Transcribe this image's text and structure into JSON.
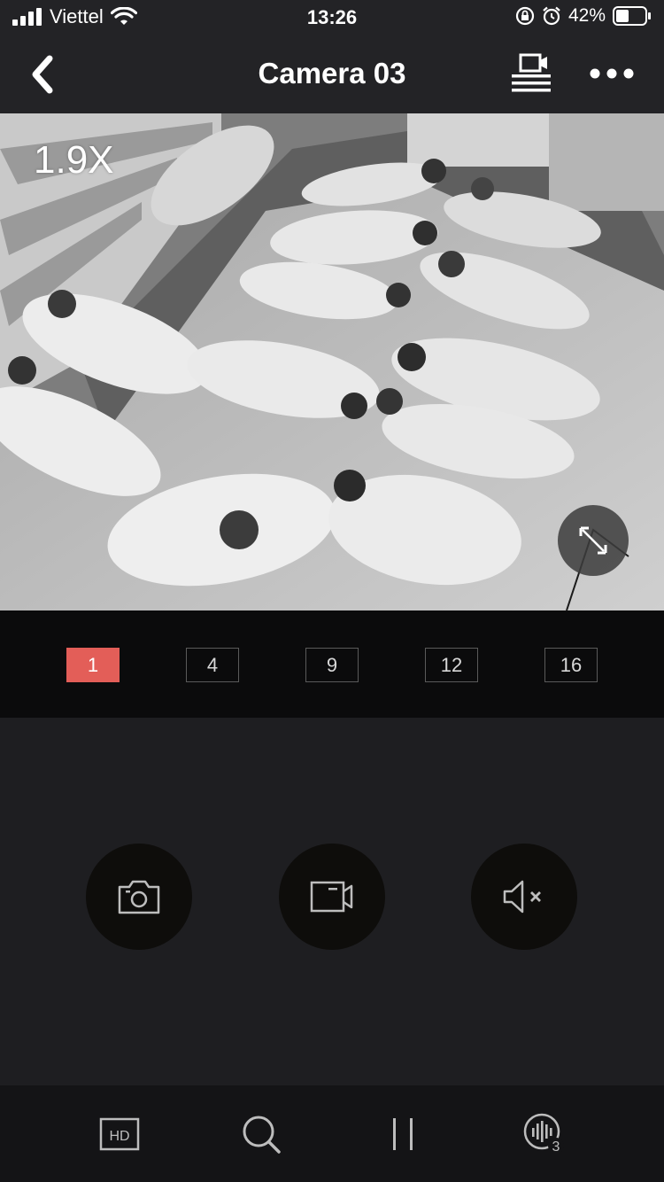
{
  "status_bar": {
    "carrier": "Viettel",
    "time": "13:26",
    "battery": "42%"
  },
  "nav": {
    "title": "Camera 03"
  },
  "video": {
    "zoom_level": "1.9X"
  },
  "grid_options": [
    {
      "label": "1",
      "selected": true
    },
    {
      "label": "4",
      "selected": false
    },
    {
      "label": "9",
      "selected": false
    },
    {
      "label": "12",
      "selected": false
    },
    {
      "label": "16",
      "selected": false
    }
  ],
  "controls": [
    "snapshot-icon",
    "record-icon",
    "mute-icon"
  ],
  "toolbar": {
    "hd_label": "HD",
    "voice_badge": "3"
  },
  "colors": {
    "accent": "#e35e58",
    "background": "#1e1e21",
    "bar": "#232326"
  }
}
